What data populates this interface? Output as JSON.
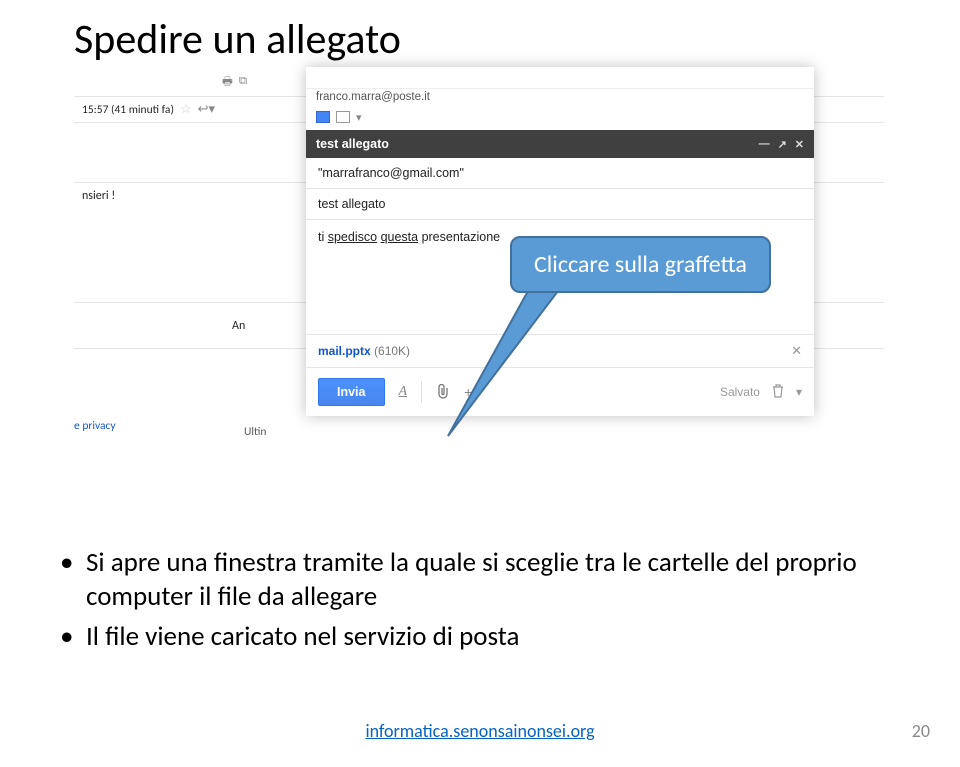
{
  "title": "Spedire un allegato",
  "background": {
    "icons_top": [
      "🖶",
      "⧉"
    ],
    "time": "15:57 (41 minuti fa)",
    "snippet_left": "nsieri !",
    "an_label": "An",
    "privacy": "e privacy",
    "ultim": "Ultin"
  },
  "compose": {
    "sender_email": "franco.marra@poste.it",
    "header_title": "test allegato",
    "to_field": "\"marrafranco@gmail.com\"",
    "subject_field": "test allegato",
    "body_prefix": "ti ",
    "body_under1": "spedisco",
    "body_mid": " ",
    "body_under2": "questa",
    "body_suffix": " presentazione",
    "attachment_name": "mail.pptx",
    "attachment_size": "(610K)",
    "send_label": "Invia",
    "saved_label": "Salvato"
  },
  "callout": "Cliccare sulla graffetta",
  "bullets": [
    "Si apre una finestra tramite la quale si sceglie tra le cartelle del proprio computer il file da allegare",
    "Il file viene caricato nel servizio di posta"
  ],
  "footer_link": "informatica.senonsainonsei.org",
  "page_number": "20"
}
